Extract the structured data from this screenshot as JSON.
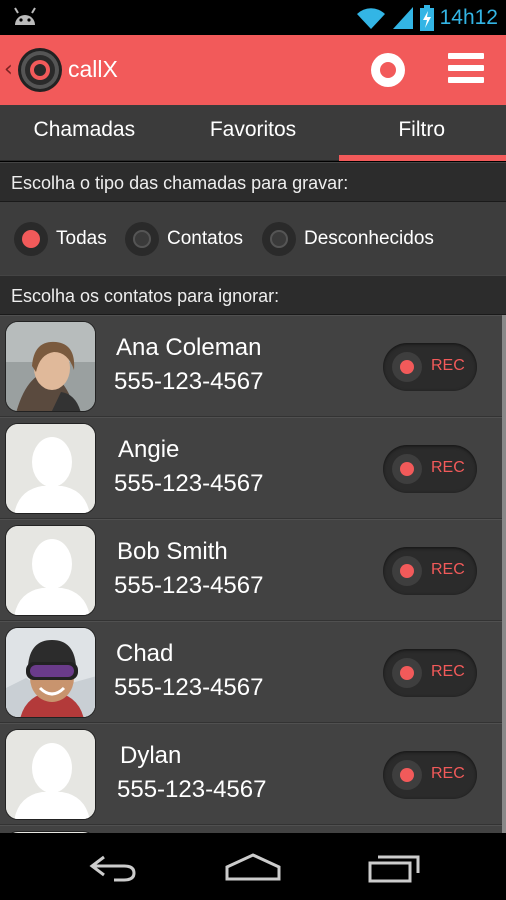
{
  "status": {
    "time": "14h12"
  },
  "app": {
    "title": "callX"
  },
  "tabs": [
    {
      "label": "Chamadas",
      "active": false
    },
    {
      "label": "Favoritos",
      "active": false
    },
    {
      "label": "Filtro",
      "active": true
    }
  ],
  "filter": {
    "type_heading": "Escolha o tipo das chamadas para gravar:",
    "options": [
      {
        "label": "Todas",
        "selected": true
      },
      {
        "label": "Contatos",
        "selected": false
      },
      {
        "label": "Desconhecidos",
        "selected": false
      }
    ],
    "ignore_heading": "Escolha os contatos para ignorar:"
  },
  "contacts": [
    {
      "name": "Ana Coleman",
      "phone": "555-123-4567",
      "avatar": "photo-woman",
      "rec_label": "REC"
    },
    {
      "name": "Angie",
      "phone": "555-123-4567",
      "avatar": "placeholder",
      "rec_label": "REC"
    },
    {
      "name": "Bob Smith",
      "phone": "555-123-4567",
      "avatar": "placeholder",
      "rec_label": "REC"
    },
    {
      "name": "Chad",
      "phone": "555-123-4567",
      "avatar": "photo-man-goggles",
      "rec_label": "REC"
    },
    {
      "name": "Dylan",
      "phone": "555-123-4567",
      "avatar": "placeholder",
      "rec_label": "REC"
    }
  ],
  "colors": {
    "accent": "#f25a5a",
    "status_blue": "#33b5e5",
    "background": "#424242"
  }
}
